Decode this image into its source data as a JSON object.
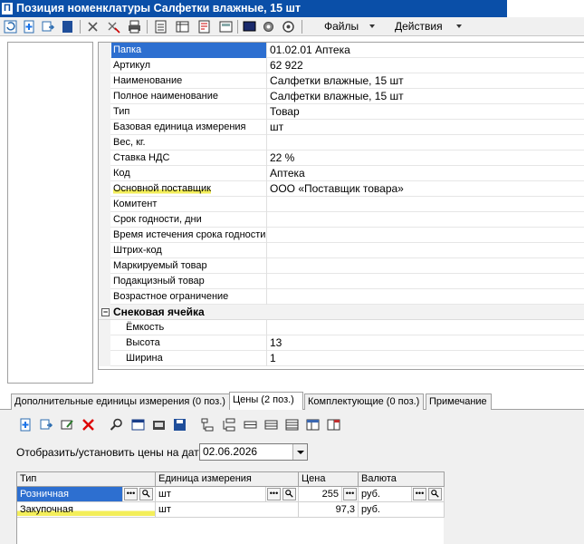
{
  "window": {
    "title": "Позиция номенклатуры Салфетки влажные, 15 шт",
    "title_icon": "П"
  },
  "toolbar": {
    "menu_files": "Файлы",
    "menu_actions": "Действия"
  },
  "properties": [
    {
      "label": "Папка",
      "value": "01.02.01 Аптека",
      "selected": true
    },
    {
      "label": "Артикул",
      "value": "62 922"
    },
    {
      "label": "Наименование",
      "value": "Салфетки влажные, 15 шт"
    },
    {
      "label": "Полное наименование",
      "value": "Салфетки влажные, 15 шт"
    },
    {
      "label": "Тип",
      "value": "Товар"
    },
    {
      "label": "Базовая единица измерения",
      "value": "шт"
    },
    {
      "label": "Вес, кг.",
      "value": ""
    },
    {
      "label": "Ставка НДС",
      "value": "22 %"
    },
    {
      "label": "Код",
      "value": "Аптека"
    },
    {
      "label": "Основной поставщик",
      "value": "ООО «Поставщик товара»",
      "highlighted": true
    },
    {
      "label": "Комитент",
      "value": ""
    },
    {
      "label": "Срок годности, дни",
      "value": ""
    },
    {
      "label": "Время истечения срока годности",
      "value": ""
    },
    {
      "label": "Штрих-код",
      "value": ""
    },
    {
      "label": "Маркируемый товар",
      "value": ""
    },
    {
      "label": "Подакцизный товар",
      "value": ""
    },
    {
      "label": "Возрастное ограничение",
      "value": ""
    }
  ],
  "section": {
    "title": "Снековая ячейка",
    "toggle": "−",
    "items": [
      {
        "label": "Ёмкость",
        "value": ""
      },
      {
        "label": "Высота",
        "value": "13"
      },
      {
        "label": "Ширина",
        "value": "1"
      }
    ]
  },
  "tabs": [
    {
      "label": "Дополнительные единицы измерения (0 поз.)"
    },
    {
      "label": "Цены (2 поз.)",
      "active": true
    },
    {
      "label": "Комплектующие (0 поз.)"
    },
    {
      "label": "Примечание"
    }
  ],
  "prices": {
    "date_label": "Отобразить/установить цены на дату:",
    "date_value": "02.06.2026",
    "columns": [
      "Тип",
      "Единица измерения",
      "Цена",
      "Валюта"
    ],
    "rows": [
      {
        "type": "Розничная",
        "unit": "шт",
        "price": "255",
        "currency": "руб."
      },
      {
        "type": "Закупочная",
        "unit": "шт",
        "price": "97,3",
        "currency": "руб."
      }
    ],
    "ellipsis": "•••",
    "lookup": "🔍"
  },
  "colors": {
    "title_bar": "#0a4fa8",
    "selection": "#2d6fd0",
    "highlight": "#f3ee5a"
  }
}
